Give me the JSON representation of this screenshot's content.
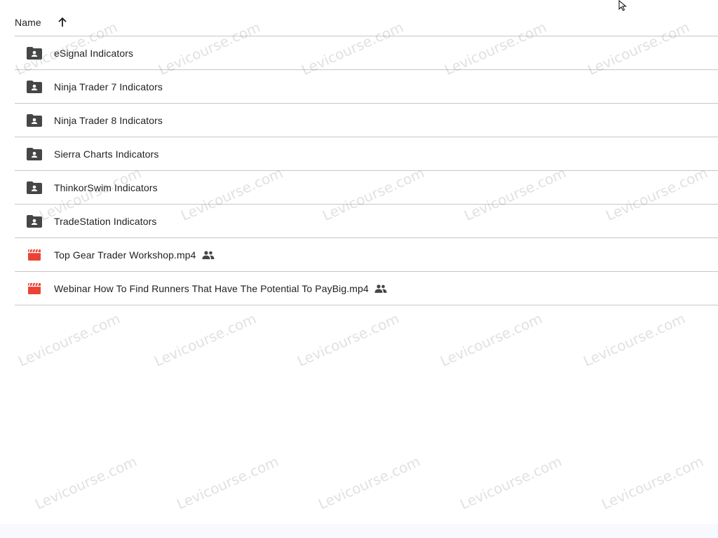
{
  "header": {
    "name_label": "Name",
    "sort_direction": "ascending"
  },
  "items": [
    {
      "name": "eSignal Indicators",
      "type": "shared-folder",
      "shared": false
    },
    {
      "name": "Ninja Trader 7 Indicators",
      "type": "shared-folder",
      "shared": false
    },
    {
      "name": "Ninja Trader 8 Indicators",
      "type": "shared-folder",
      "shared": false
    },
    {
      "name": "Sierra Charts Indicators",
      "type": "shared-folder",
      "shared": false
    },
    {
      "name": "ThinkorSwim Indicators",
      "type": "shared-folder",
      "shared": false
    },
    {
      "name": "TradeStation Indicators",
      "type": "shared-folder",
      "shared": false
    },
    {
      "name": "Top Gear Trader Workshop.mp4",
      "type": "video",
      "shared": true
    },
    {
      "name": "Webinar How To Find Runners That Have The Potential To PayBig.mp4",
      "type": "video",
      "shared": true
    }
  ],
  "watermark": {
    "text": "Levicourse.com"
  },
  "colors": {
    "folder_icon": "#444746",
    "video_icon": "#ea4335",
    "divider": "#c7c7c7",
    "text": "#1f1f1f"
  }
}
